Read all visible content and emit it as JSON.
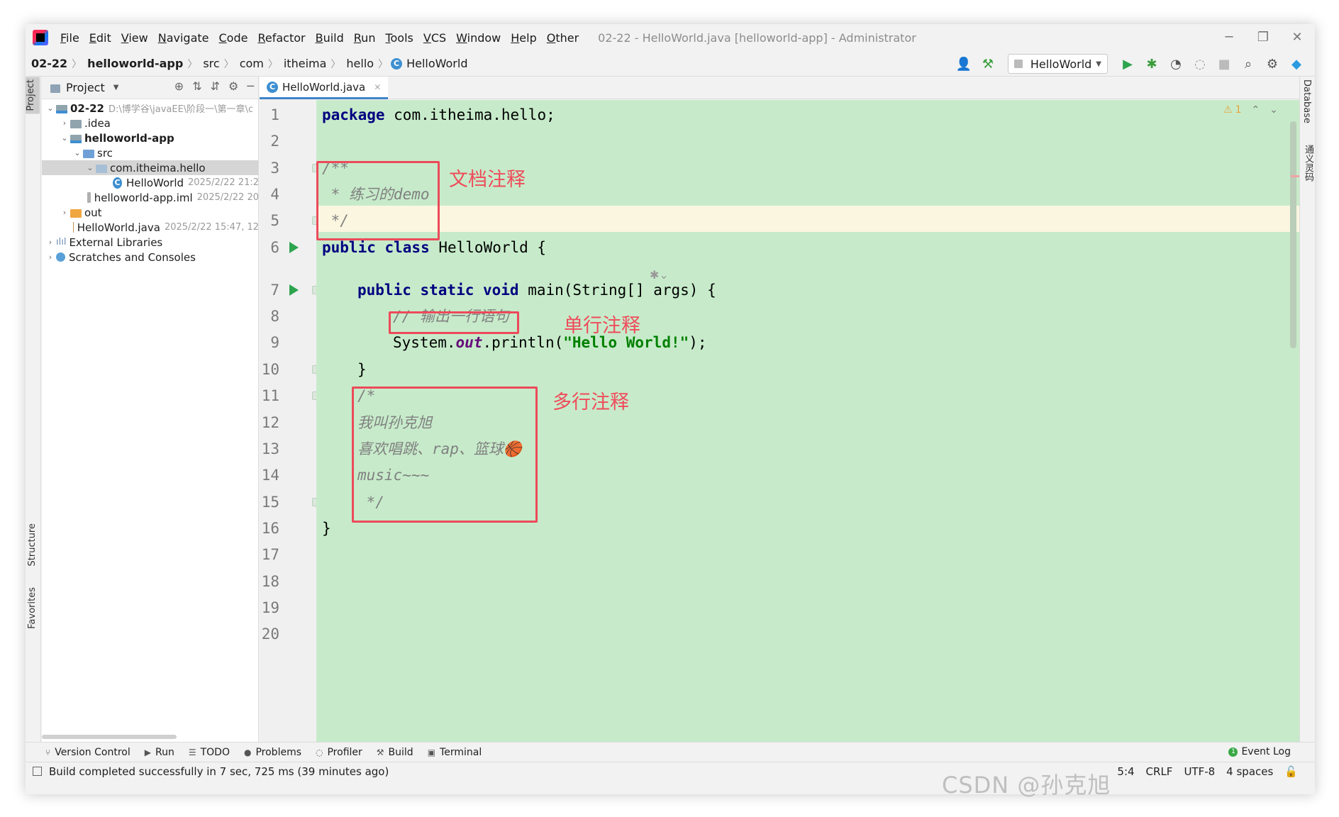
{
  "menu": {
    "items": [
      "File",
      "Edit",
      "View",
      "Navigate",
      "Code",
      "Refactor",
      "Build",
      "Run",
      "Tools",
      "VCS",
      "Window",
      "Help",
      "Other"
    ],
    "window_title": "02-22 - HelloWorld.java [helloworld-app] - Administrator"
  },
  "navbar": {
    "crumbs": [
      "02-22",
      "helloworld-app",
      "src",
      "com",
      "itheima",
      "hello",
      "HelloWorld"
    ],
    "run_config": "HelloWorld"
  },
  "project": {
    "header": "Project",
    "tree": [
      {
        "label": "02-22",
        "meta": "D:\\博学谷\\javaEE\\阶段一\\第一章\\c"
      },
      {
        "label": ".idea",
        "meta": ""
      },
      {
        "label": "helloworld-app",
        "meta": ""
      },
      {
        "label": "src",
        "meta": ""
      },
      {
        "label": "com.itheima.hello",
        "meta": ""
      },
      {
        "label": "HelloWorld",
        "meta": "2025/2/22 21:2"
      },
      {
        "label": "helloworld-app.iml",
        "meta": "2025/2/22 20"
      },
      {
        "label": "out",
        "meta": ""
      },
      {
        "label": "HelloWorld.java",
        "meta": "2025/2/22 15:47, 12"
      },
      {
        "label": "External Libraries",
        "meta": ""
      },
      {
        "label": "Scratches and Consoles",
        "meta": ""
      }
    ]
  },
  "side": {
    "left_project": "Project",
    "left_structure": "Structure",
    "left_favorites": "Favorites",
    "right_database": "Database",
    "right_plugin": "通义灵码"
  },
  "editor": {
    "tab": "HelloWorld.java",
    "warnings": "1",
    "line_numbers": [
      "1",
      "2",
      "3",
      "4",
      "5",
      "6",
      "7",
      "8",
      "9",
      "10",
      "11",
      "12",
      "13",
      "14",
      "15",
      "16",
      "17",
      "18",
      "19",
      "20"
    ],
    "code": {
      "l1_kw": "package",
      "l1_rest": " com.itheima.hello;",
      "l3": "/**",
      "l4": " * 练习的demo",
      "l5": " */",
      "l6_kw": "public class",
      "l6_rest": " HelloWorld {",
      "l7_kw": "public static void",
      "l7_rest": " main(String[] args) {",
      "l8": "// 输出一行语句",
      "l9_a": "System.",
      "l9_out": "out",
      "l9_b": ".println(",
      "l9_str": "\"Hello World!\"",
      "l9_c": ");",
      "l10": "}",
      "l11": "/*",
      "l12": "我叫孙克旭",
      "l13": "喜欢唱跳、rap、篮球🏀",
      "l14": "music~~~",
      "l15": " */",
      "l16": "}"
    },
    "annotations": {
      "doc": "文档注释",
      "single": "单行注释",
      "multi": "多行注释"
    }
  },
  "toolwindows": {
    "items": [
      "Version Control",
      "Run",
      "TODO",
      "Problems",
      "Profiler",
      "Build",
      "Terminal"
    ],
    "event_log": "Event Log",
    "event_count": "1"
  },
  "status": {
    "message": "Build completed successfully in 7 sec, 725 ms (39 minutes ago)",
    "position": "5:4",
    "line_sep": "CRLF",
    "encoding": "UTF-8",
    "indent": "4 spaces"
  },
  "watermark": "CSDN @孙克旭",
  "colors": {
    "code_bg": "#c7ebca",
    "keyword": "#000080",
    "string": "#008000",
    "comment": "#808080",
    "annotation": "#ef4b5b"
  }
}
